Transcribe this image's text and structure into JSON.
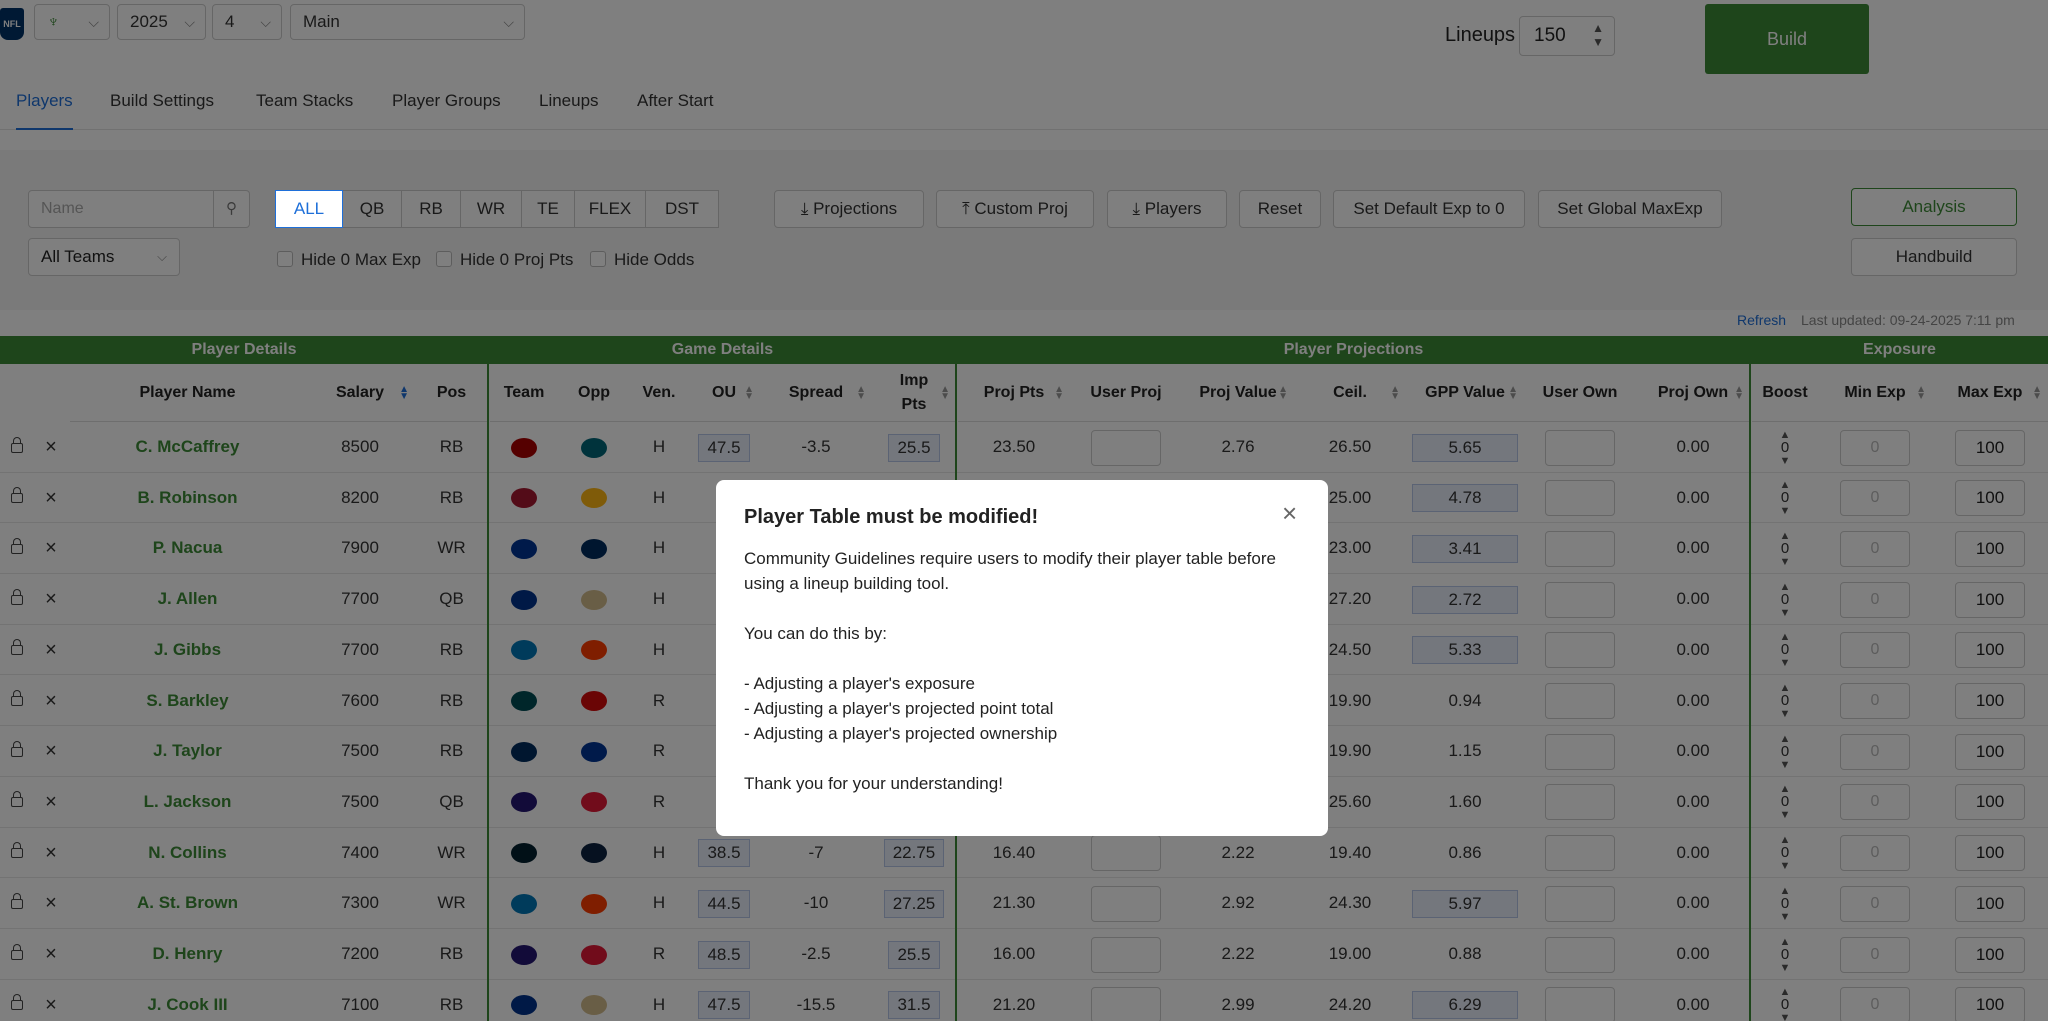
{
  "topbar": {
    "site_select": "",
    "year": "2025",
    "week": "4",
    "slate": "Main",
    "lineups_label": "Lineups",
    "lineups_value": "150",
    "build_label": "Build"
  },
  "tabs": [
    "Players",
    "Build Settings",
    "Team Stacks",
    "Player Groups",
    "Lineups",
    "After Start"
  ],
  "filters": {
    "name_placeholder": "Name",
    "positions": [
      "ALL",
      "QB",
      "RB",
      "WR",
      "TE",
      "FLEX",
      "DST"
    ],
    "actions": {
      "projections": "Projections",
      "custom_proj": "Custom Proj",
      "players": "Players",
      "reset": "Reset",
      "default_exp": "Set Default Exp to 0",
      "global_max": "Set Global MaxExp",
      "analysis": "Analysis",
      "handbuild": "Handbuild"
    },
    "teams": "All Teams",
    "checkboxes": [
      "Hide 0 Max Exp",
      "Hide 0 Proj Pts",
      "Hide Odds"
    ]
  },
  "refresh": {
    "link": "Refresh",
    "last_updated": "Last updated: 09-24-2025 7:11 pm"
  },
  "table": {
    "groups": [
      "Player Details",
      "Game Details",
      "Player Projections",
      "Exposure"
    ],
    "columns": {
      "name": "Player Name",
      "salary": "Salary",
      "pos": "Pos",
      "team": "Team",
      "opp": "Opp",
      "ven": "Ven.",
      "ou": "OU",
      "spread": "Spread",
      "imp": "Imp Pts",
      "proj_pts": "Proj Pts",
      "user_proj": "User Proj",
      "proj_value": "Proj Value",
      "ceil": "Ceil.",
      "gpp_value": "GPP Value",
      "user_own": "User Own",
      "proj_own": "Proj Own",
      "boost": "Boost",
      "min_exp": "Min Exp",
      "max_exp": "Max Exp"
    },
    "rows": [
      {
        "name": "C. McCaffrey",
        "salary": "8500",
        "pos": "RB",
        "team_color": "#aa0000",
        "opp_color": "#006778",
        "ven": "H",
        "ou": "47.5",
        "spread": "-3.5",
        "imp": "25.5",
        "proj": "23.50",
        "value": "2.76",
        "ceil": "26.50",
        "gpp": "5.65",
        "own": "0.00",
        "boost": "0",
        "min": "0",
        "max": "100"
      },
      {
        "name": "B. Robinson",
        "salary": "8200",
        "pos": "RB",
        "team_color": "#a71930",
        "opp_color": "#ffb612",
        "ven": "H",
        "ou": "4",
        "spread": "",
        "imp": "",
        "proj": "",
        "value": "",
        "ceil": "25.00",
        "gpp": "4.78",
        "own": "0.00",
        "boost": "0",
        "min": "0",
        "max": "100"
      },
      {
        "name": "P. Nacua",
        "salary": "7900",
        "pos": "WR",
        "team_color": "#003594",
        "opp_color": "#002c5f",
        "ven": "H",
        "ou": "4",
        "spread": "",
        "imp": "",
        "proj": "",
        "value": "",
        "ceil": "23.00",
        "gpp": "3.41",
        "own": "0.00",
        "boost": "0",
        "min": "0",
        "max": "100"
      },
      {
        "name": "J. Allen",
        "salary": "7700",
        "pos": "QB",
        "team_color": "#00338d",
        "opp_color": "#d3bc8d",
        "ven": "H",
        "ou": "4",
        "spread": "",
        "imp": "",
        "proj": "",
        "value": "",
        "ceil": "27.20",
        "gpp": "2.72",
        "own": "0.00",
        "boost": "0",
        "min": "0",
        "max": "100"
      },
      {
        "name": "J. Gibbs",
        "salary": "7700",
        "pos": "RB",
        "team_color": "#0076b6",
        "opp_color": "#ff3c00",
        "ven": "H",
        "ou": "4",
        "spread": "",
        "imp": "",
        "proj": "",
        "value": "",
        "ceil": "24.50",
        "gpp": "5.33",
        "own": "0.00",
        "boost": "0",
        "min": "0",
        "max": "100"
      },
      {
        "name": "S. Barkley",
        "salary": "7600",
        "pos": "RB",
        "team_color": "#004c54",
        "opp_color": "#d50a0a",
        "ven": "R",
        "ou": "4",
        "spread": "",
        "imp": "",
        "proj": "",
        "value": "",
        "ceil": "19.90",
        "gpp": "0.94",
        "own": "0.00",
        "boost": "0",
        "min": "0",
        "max": "100"
      },
      {
        "name": "J. Taylor",
        "salary": "7500",
        "pos": "RB",
        "team_color": "#002c5f",
        "opp_color": "#003594",
        "ven": "R",
        "ou": "4",
        "spread": "",
        "imp": "",
        "proj": "",
        "value": "",
        "ceil": "19.90",
        "gpp": "1.15",
        "own": "0.00",
        "boost": "0",
        "min": "0",
        "max": "100"
      },
      {
        "name": "L. Jackson",
        "salary": "7500",
        "pos": "QB",
        "team_color": "#241773",
        "opp_color": "#e31837",
        "ven": "R",
        "ou": "4",
        "spread": "",
        "imp": "",
        "proj": "",
        "value": "",
        "ceil": "25.60",
        "gpp": "1.60",
        "own": "0.00",
        "boost": "0",
        "min": "0",
        "max": "100"
      },
      {
        "name": "N. Collins",
        "salary": "7400",
        "pos": "WR",
        "team_color": "#03202f",
        "opp_color": "#0c2340",
        "ven": "H",
        "ou": "38.5",
        "spread": "-7",
        "imp": "22.75",
        "proj": "16.40",
        "value": "2.22",
        "ceil": "19.40",
        "gpp": "0.86",
        "own": "0.00",
        "boost": "0",
        "min": "0",
        "max": "100"
      },
      {
        "name": "A. St. Brown",
        "salary": "7300",
        "pos": "WR",
        "team_color": "#0076b6",
        "opp_color": "#ff3c00",
        "ven": "H",
        "ou": "44.5",
        "spread": "-10",
        "imp": "27.25",
        "proj": "21.30",
        "value": "2.92",
        "ceil": "24.30",
        "gpp": "5.97",
        "own": "0.00",
        "boost": "0",
        "min": "0",
        "max": "100"
      },
      {
        "name": "D. Henry",
        "salary": "7200",
        "pos": "RB",
        "team_color": "#241773",
        "opp_color": "#e31837",
        "ven": "R",
        "ou": "48.5",
        "spread": "-2.5",
        "imp": "25.5",
        "proj": "16.00",
        "value": "2.22",
        "ceil": "19.00",
        "gpp": "0.88",
        "own": "0.00",
        "boost": "0",
        "min": "0",
        "max": "100"
      },
      {
        "name": "J. Cook III",
        "salary": "7100",
        "pos": "RB",
        "team_color": "#00338d",
        "opp_color": "#d3bc8d",
        "ven": "H",
        "ou": "47.5",
        "spread": "-15.5",
        "imp": "31.5",
        "proj": "21.20",
        "value": "2.99",
        "ceil": "24.20",
        "gpp": "6.29",
        "own": "0.00",
        "boost": "0",
        "min": "0",
        "max": "100"
      }
    ]
  },
  "modal": {
    "title": "Player Table must be modified!",
    "line1": "Community Guidelines require users to modify their player table before using a lineup building tool.",
    "line2": "You can do this by:",
    "bullet1": "- Adjusting a player's exposure",
    "bullet2": "- Adjusting a player's projected point total",
    "bullet3": "- Adjusting a player's projected ownership",
    "line3": "Thank you for your understanding!"
  },
  "colors": {
    "accent_green": "#3d8b37",
    "accent_blue": "#1e6fd9"
  }
}
